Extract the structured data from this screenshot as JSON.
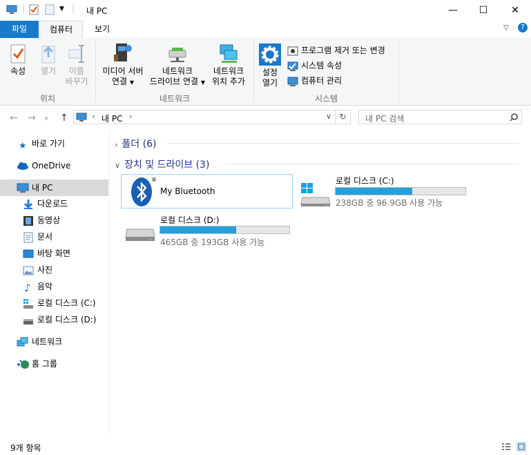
{
  "window": {
    "title": "내 PC",
    "minimize": "—",
    "maximize": "☐",
    "close": "✕"
  },
  "ribbon_tabs": {
    "file": "파일",
    "computer": "컴퓨터",
    "view": "보기"
  },
  "ribbon": {
    "properties": "속성",
    "open": "열기",
    "rename_line1": "이름",
    "rename_line2": "바꾸기",
    "group_location": "위치",
    "media_line1": "미디어 서버",
    "media_line2": "연결",
    "mapdrive_line1": "네트워크",
    "mapdrive_line2": "드라이브 연결",
    "addloc_line1": "네트워크",
    "addloc_line2": "위치 추가",
    "group_network": "네트워크",
    "settings_line1": "설정",
    "settings_line2": "열기",
    "uninstall": "프로그램 제거 또는 변경",
    "sysprops": "시스템 속성",
    "manage": "컴퓨터 관리",
    "group_system": "시스템"
  },
  "address": {
    "path": "내 PC",
    "search_placeholder": "내 PC 검색"
  },
  "nav": {
    "quick_access": "바로 가기",
    "onedrive": "OneDrive",
    "this_pc": "내 PC",
    "downloads": "다운로드",
    "videos": "동영상",
    "documents": "문서",
    "desktop": "바탕 화면",
    "pictures": "사진",
    "music": "음악",
    "local_c": "로컬 디스크 (C:)",
    "local_d": "로컬 디스크 (D:)",
    "network": "네트워크",
    "homegroup": "홈 그룹"
  },
  "content": {
    "folders_header": "폴더 (6)",
    "devices_header": "장치 및 드라이브 (3)",
    "bluetooth_name": "My Bluetooth",
    "drive_c": {
      "name": "로컬 디스크 (C:)",
      "detail": "238GB 중 96.9GB 사용 가능",
      "used_fraction": 0.59
    },
    "drive_d": {
      "name": "로컬 디스크 (D:)",
      "detail": "465GB 중 193GB 사용 가능",
      "used_fraction": 0.59
    }
  },
  "status": {
    "count": "9개 항목"
  },
  "colors": {
    "accent": "#1979ca",
    "bar_fill": "#26a0da",
    "header_text": "#1e3287"
  }
}
